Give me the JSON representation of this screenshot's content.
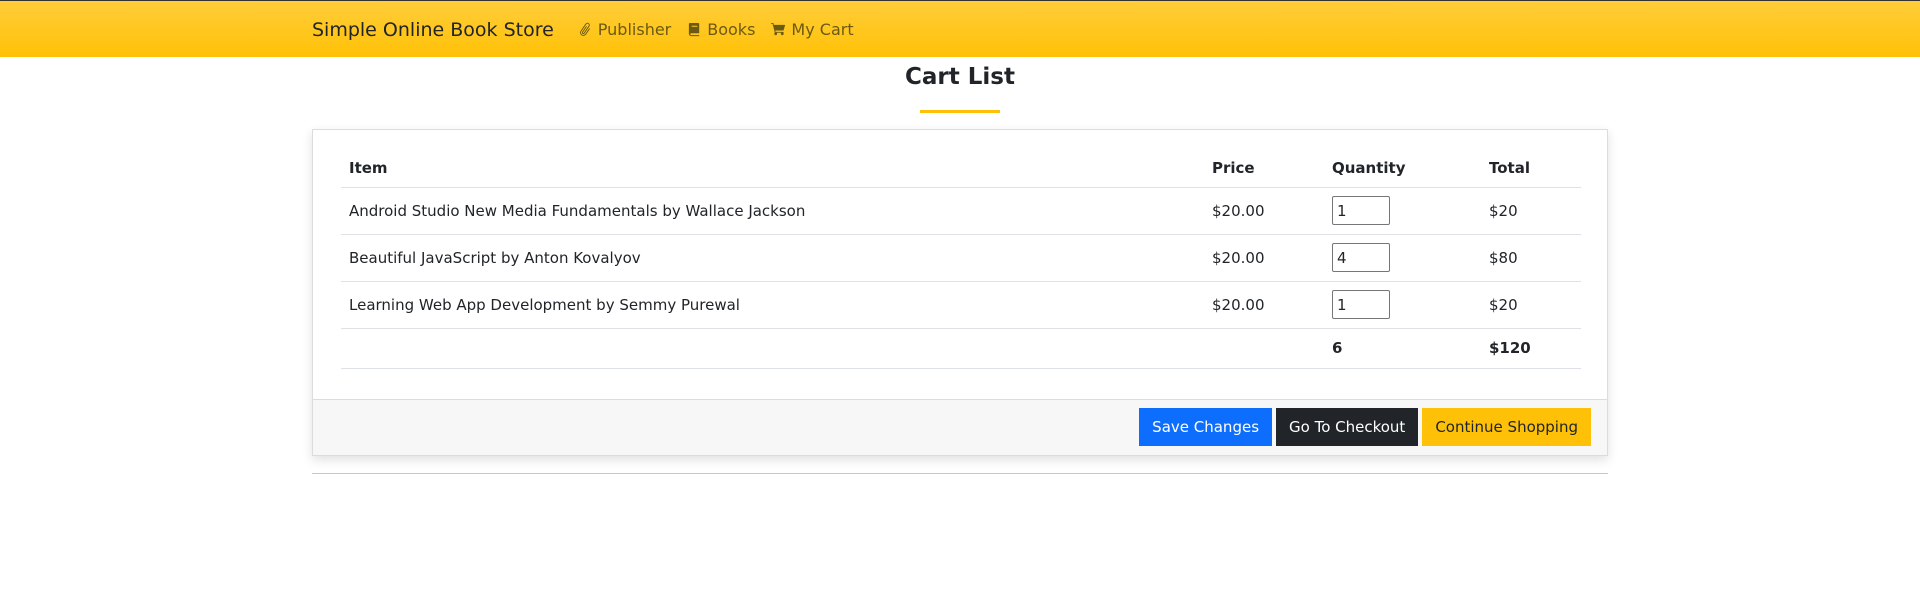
{
  "navbar": {
    "brand": "Simple Online Book Store",
    "links": [
      {
        "label": "Publisher",
        "icon": "paperclip-icon"
      },
      {
        "label": "Books",
        "icon": "book-icon"
      },
      {
        "label": "My Cart",
        "icon": "cart-icon"
      }
    ]
  },
  "page": {
    "title": "Cart List"
  },
  "cart": {
    "headers": {
      "item": "Item",
      "price": "Price",
      "quantity": "Quantity",
      "total": "Total"
    },
    "rows": [
      {
        "item": "Android Studio New Media Fundamentals by Wallace Jackson",
        "price": "$20.00",
        "quantity": "1",
        "total": "$20"
      },
      {
        "item": "Beautiful JavaScript by Anton Kovalyov",
        "price": "$20.00",
        "quantity": "4",
        "total": "$80"
      },
      {
        "item": "Learning Web App Development by Semmy Purewal",
        "price": "$20.00",
        "quantity": "1",
        "total": "$20"
      }
    ],
    "summary": {
      "total_quantity": "6",
      "grand_total": "$120"
    }
  },
  "actions": {
    "save_label": "Save Changes",
    "checkout_label": "Go To Checkout",
    "continue_label": "Continue Shopping"
  },
  "colors": {
    "navbar": "#ffc107",
    "primary": "#0d6efd",
    "dark": "#212529",
    "warning": "#ffc107"
  }
}
